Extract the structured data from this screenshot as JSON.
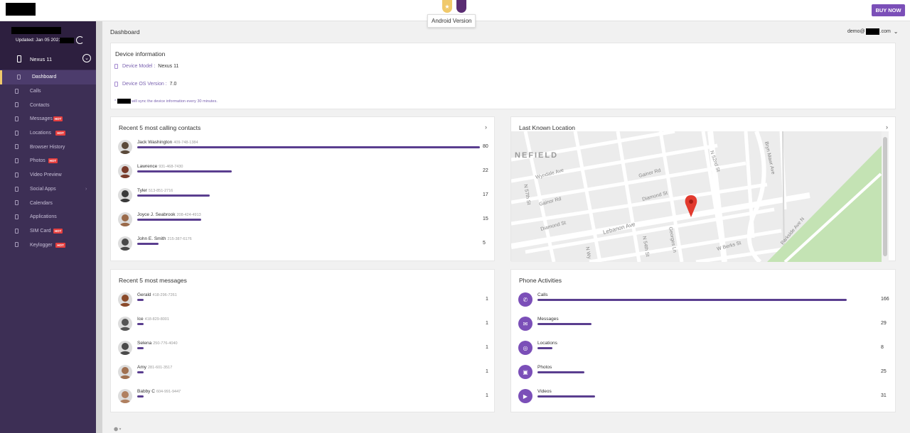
{
  "topbar": {
    "tooltip": "Android Version",
    "buy_now": "BUY NOW"
  },
  "sidebar": {
    "updated": "Updated: Jan 05 2021",
    "device": "Nexus 11",
    "items": [
      {
        "label": "Dashboard",
        "hot": false
      },
      {
        "label": "Calls",
        "hot": false
      },
      {
        "label": "Contacts",
        "hot": false
      },
      {
        "label": "Messages",
        "hot": true
      },
      {
        "label": "Locations",
        "hot": true
      },
      {
        "label": "Browser History",
        "hot": false
      },
      {
        "label": "Photos",
        "hot": true
      },
      {
        "label": "Video Preview",
        "hot": false
      },
      {
        "label": "Social Apps",
        "hot": false
      },
      {
        "label": "Calendars",
        "hot": false
      },
      {
        "label": "Applications",
        "hot": false
      },
      {
        "label": "SIM Card",
        "hot": true
      },
      {
        "label": "Keylogger",
        "hot": true
      }
    ],
    "hot_label": "HOT"
  },
  "header": {
    "title": "Dashboard",
    "user_prefix": "demo@",
    "user_suffix": ".com"
  },
  "device_info": {
    "title": "Device information",
    "model_label": "Device Model :",
    "model_value": "Nexus 11",
    "os_label": "Device OS Version :",
    "os_value": "7.0",
    "sync_prefix": "*",
    "sync_note": "will sync the device information every 30 minutes."
  },
  "calling": {
    "title": "Recent 5 most calling contacts",
    "arrow": "›",
    "max": 80,
    "contacts": [
      {
        "name": "Jack Washington",
        "phone": "409-748-1384",
        "count": 80,
        "avatar": "#5b4a3a"
      },
      {
        "name": "Lawrence",
        "phone": "931-468-7430",
        "count": 22,
        "avatar": "#7a3b2a"
      },
      {
        "name": "Tyler",
        "phone": "513-851-2716",
        "count": 17,
        "avatar": "#3a3a3a"
      },
      {
        "name": "Joyce J. Seabrook",
        "phone": "208-424-4913",
        "count": 15,
        "avatar": "#9a6a4a"
      },
      {
        "name": "John E. Smith",
        "phone": "215-387-6176",
        "count": 5,
        "avatar": "#4a4a4a"
      }
    ]
  },
  "location": {
    "title": "Last Known Location",
    "arrow": "›",
    "map": {
      "neighborhood": "NEFIELD",
      "streets": [
        "Wyndale Ave",
        "Gainor Rd",
        "Gainor Rd",
        "Diamond St",
        "Diamond St",
        "Lebanon Ave",
        "N 57th St",
        "N 54th St",
        "N 52nd St",
        "Bryn Mawr Ave",
        "Parkside Ave N",
        "W Berks St",
        "Georges Ln",
        "N Wy"
      ]
    }
  },
  "messages": {
    "title": "Recent 5 most messages",
    "contacts": [
      {
        "name": "Gerald",
        "phone": "418-296-7261",
        "count": 1,
        "avatar": "#8a4a2a"
      },
      {
        "name": "Ice",
        "phone": "418-829-8001",
        "count": 1,
        "avatar": "#555"
      },
      {
        "name": "Selena",
        "phone": "250-776-4040",
        "count": 1,
        "avatar": "#4a4a4a"
      },
      {
        "name": "Amy",
        "phone": "281-601-3517",
        "count": 1,
        "avatar": "#a07050"
      },
      {
        "name": "Babby C",
        "phone": "604-991-9447",
        "count": 1,
        "avatar": "#b08060"
      }
    ]
  },
  "activities": {
    "title": "Phone Activities",
    "max": 166,
    "items": [
      {
        "label": "Calls",
        "count": 166,
        "icon": "phone-icon",
        "glyph": "✆"
      },
      {
        "label": "Messages",
        "count": 29,
        "icon": "message-icon",
        "glyph": "✉"
      },
      {
        "label": "Locations",
        "count": 8,
        "icon": "location-icon",
        "glyph": "◎"
      },
      {
        "label": "Photos",
        "count": 25,
        "icon": "photo-icon",
        "glyph": "▣"
      },
      {
        "label": "Videos",
        "count": 31,
        "icon": "video-icon",
        "glyph": "▶"
      }
    ]
  }
}
